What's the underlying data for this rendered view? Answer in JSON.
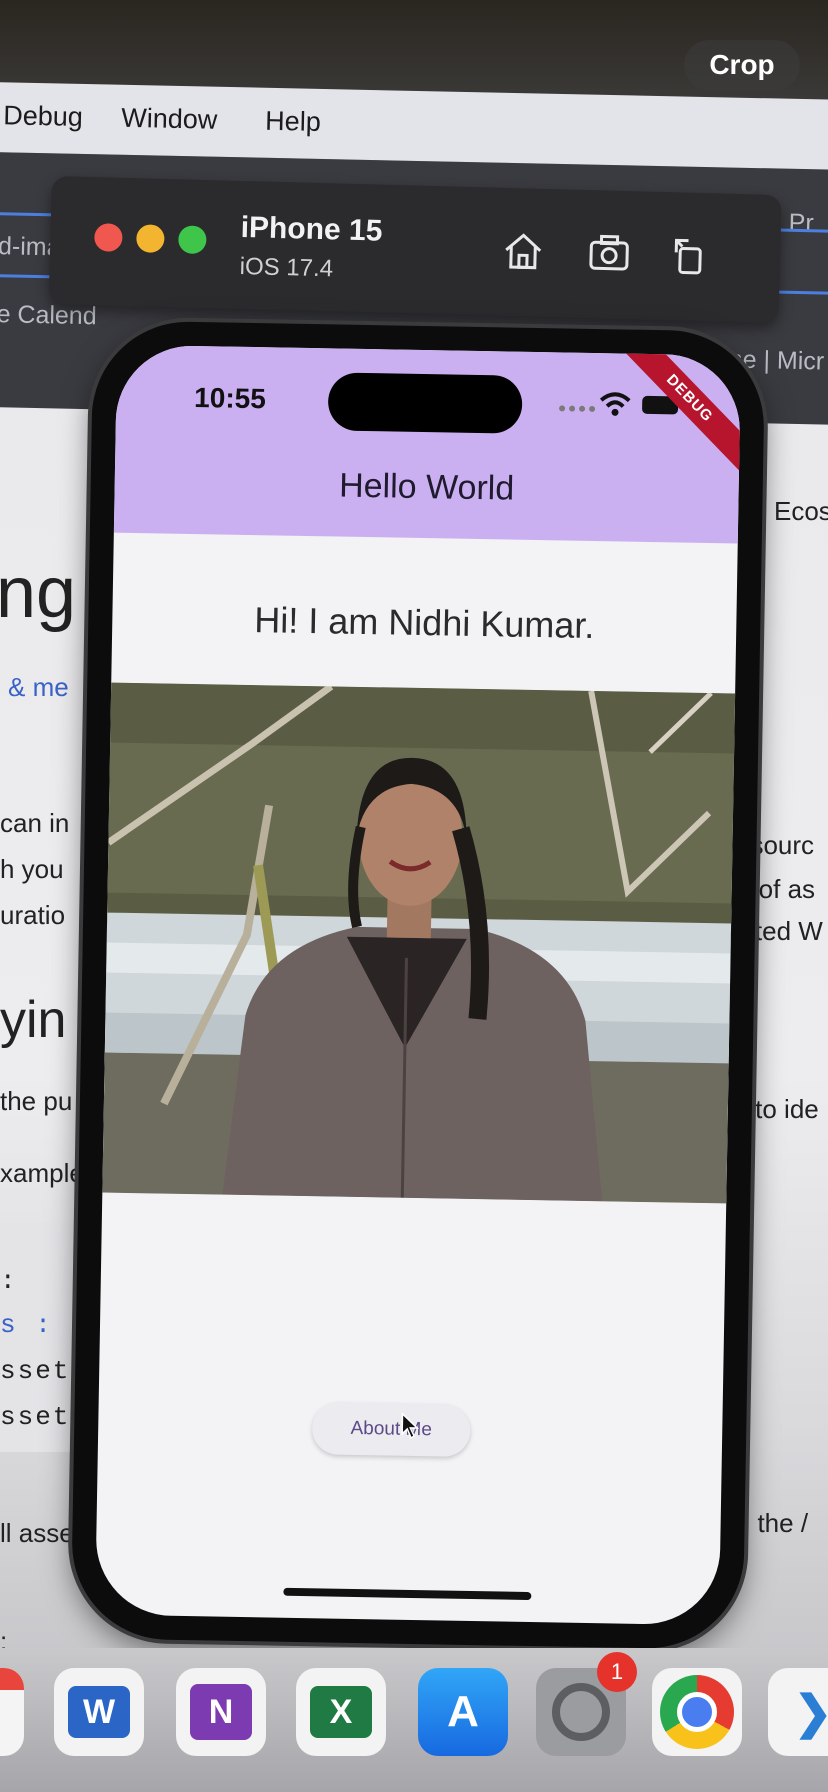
{
  "background": {
    "menu": [
      "Debug",
      "Window",
      "Help"
    ],
    "browser_fragments": [
      "d-images",
      "e Calend",
      "me | Micr",
      "Pr"
    ],
    "page_fragments": {
      "heading_top": "ng",
      "link_top": "& me",
      "left_lines": [
        "can in",
        "h you",
        "uratio"
      ],
      "heading_mid": "yin",
      "left_mid": "the",
      "left_mid_link": "pu",
      "left_example": "xample",
      "right_top": "Ecos",
      "right_lines": [
        "esourc",
        "es of as",
        "nated W"
      ],
      "right_mid": "ect, to ide",
      "code_lines": [
        ":",
        "s :",
        "ssets/",
        "ssets/"
      ],
      "bottom_left": "ll asset",
      "bottom_right": "with the /",
      "colon_bottom": ":"
    }
  },
  "crop_label": "Crop",
  "simulator": {
    "device": "iPhone 15",
    "os": "iOS 17.4"
  },
  "phone": {
    "time": "10:55",
    "debug_banner": "DEBUG",
    "app_title": "Hello World",
    "greeting": "Hi! I am Nidhi Kumar.",
    "button_label": "About Me"
  },
  "dock": {
    "icons": [
      "word-icon",
      "onenote-icon",
      "excel-icon",
      "app-store-icon",
      "system-settings-icon",
      "chrome-icon",
      "vscode-icon"
    ],
    "settings_badge": "1"
  },
  "colors": {
    "app_bar": "#cbb0f1",
    "debug": "#b7152e",
    "button_text": "#5b4a86"
  }
}
